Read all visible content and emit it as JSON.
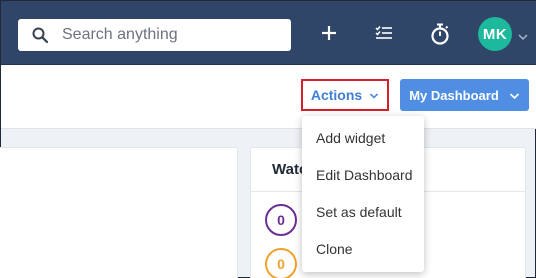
{
  "search": {
    "placeholder": "Search anything",
    "icon": "search-icon"
  },
  "topbar_icons": [
    "plus-icon",
    "task-list-icon",
    "stopwatch-icon"
  ],
  "user": {
    "initials": "MK",
    "avatar_color": "#1db99c"
  },
  "toolbar": {
    "actions_label": "Actions",
    "dashboard_label": "My Dashboard"
  },
  "actions_menu": {
    "items": [
      "Add widget",
      "Edit Dashboard",
      "Set as default",
      "Clone"
    ]
  },
  "widget": {
    "title_visible": "Watc",
    "counts": [
      "0",
      "0"
    ]
  },
  "colors": {
    "topbar": "#2f4668",
    "accent": "#4f8ee3",
    "actions_text": "#3f7fd6",
    "highlight_border": "#d3202a",
    "count_purple": "#6b2e93",
    "count_orange": "#f0a229"
  }
}
